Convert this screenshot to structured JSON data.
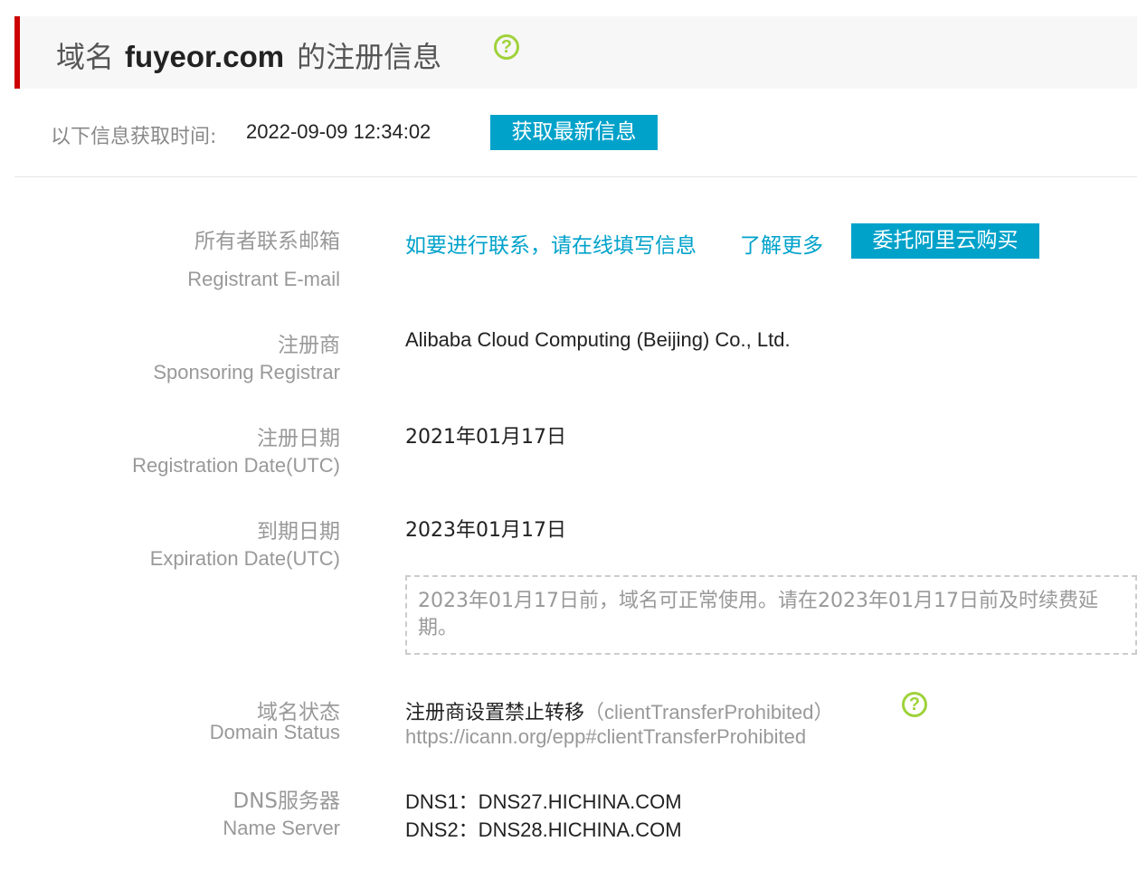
{
  "header": {
    "prefix": "域名",
    "domain": "fuyeor.com",
    "suffix": "的注册信息",
    "help_icon": "question-circle-icon"
  },
  "fetch": {
    "label": "以下信息获取时间:",
    "time": "2022-09-09 12:34:02",
    "refresh_button": "获取最新信息"
  },
  "fields": {
    "email": {
      "label_zh": "所有者联系邮箱",
      "label_en": "Registrant E-mail",
      "contact_link": "如要进行联系，请在线填写信息",
      "learn_more_link": "了解更多",
      "buy_button": "委托阿里云购买"
    },
    "registrar": {
      "label_zh": "注册商",
      "label_en": "Sponsoring Registrar",
      "value": "Alibaba Cloud Computing (Beijing) Co., Ltd."
    },
    "registration_date": {
      "label_zh": "注册日期",
      "label_en": "Registration Date(UTC)",
      "value": "2021年01月17日"
    },
    "expiration_date": {
      "label_zh": "到期日期",
      "label_en": "Expiration Date(UTC)",
      "value": "2023年01月17日",
      "notice": "2023年01月17日前，域名可正常使用。请在2023年01月17日前及时续费延期。"
    },
    "domain_status": {
      "label_zh": "域名状态",
      "label_en": "Domain Status",
      "status_zh": "注册商设置禁止转移",
      "status_en": "（clientTransferProhibited）",
      "help_icon": "question-circle-icon",
      "url": "https://icann.org/epp#clientTransferProhibited"
    },
    "dns": {
      "label_zh": "DNS服务器",
      "label_en": "Name Server",
      "dns1": "DNS1：DNS27.HICHINA.COM",
      "dns2": "DNS2：DNS28.HICHINA.COM"
    }
  },
  "colors": {
    "accent": "#00a2ca",
    "header_bar": "#cc0000",
    "help_icon": "#9fd23a"
  }
}
